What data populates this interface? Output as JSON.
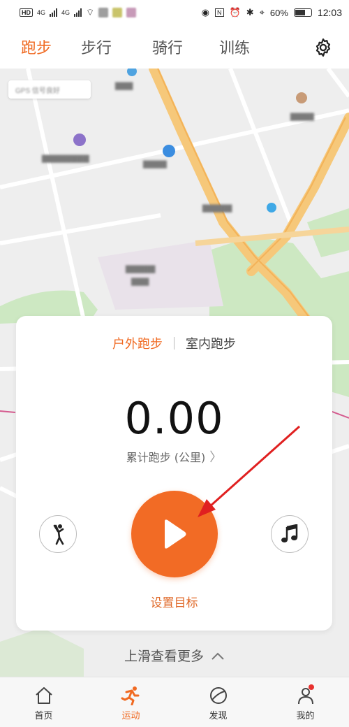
{
  "status_bar": {
    "hd": "HD",
    "net1": "4G",
    "net2": "4G",
    "battery": "60%",
    "time": "12:03"
  },
  "tabs": [
    {
      "label": "跑步",
      "active": true
    },
    {
      "label": "步行",
      "active": false
    },
    {
      "label": "骑行",
      "active": false
    },
    {
      "label": "训练",
      "active": false
    }
  ],
  "map": {
    "gps_label": "GPS 信号良好"
  },
  "card": {
    "mode_active": "户外跑步",
    "mode_other": "室内跑步",
    "distance": "0.00",
    "distance_label": "累计跑步 (公里)",
    "goal": "设置目标"
  },
  "swipe_hint": "上滑查看更多",
  "nav": [
    {
      "label": "首页",
      "icon": "home-icon"
    },
    {
      "label": "运动",
      "icon": "running-icon"
    },
    {
      "label": "发现",
      "icon": "discover-icon"
    },
    {
      "label": "我的",
      "icon": "profile-icon"
    }
  ],
  "colors": {
    "accent": "#f06a22",
    "play_button": "#f26b25",
    "annotation_arrow": "#e02020"
  }
}
